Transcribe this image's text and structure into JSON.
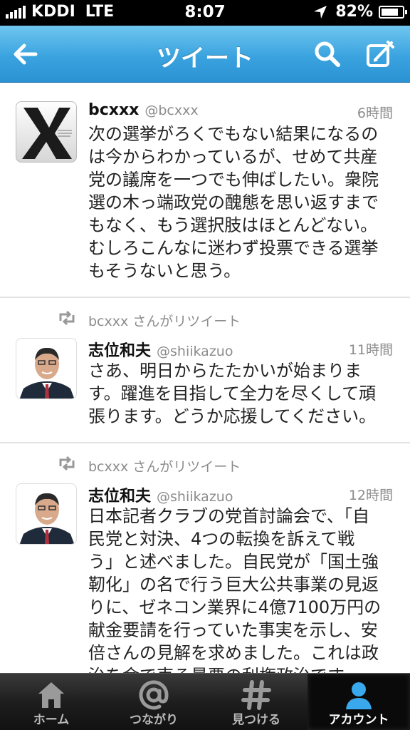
{
  "status_bar": {
    "carrier": "KDDI",
    "network": "LTE",
    "time": "8:07",
    "battery": "82%",
    "battery_level": 0.82
  },
  "nav": {
    "title": "ツイート"
  },
  "tweets": [
    {
      "name": "bcxxx",
      "handle": "@bcxxx",
      "time": "6時間",
      "lines": [
        "次の選挙がろくでもない結果になるの",
        "は今からわかっているが、せめて共産",
        "党の議席を一つでも伸ばしたい。衆院",
        "選の木っ端政党の醜態を思い返すまで",
        "もなく、もう選択肢はほとんどない。",
        "むしろこんなに迷わず投票できる選挙",
        "もそうないと思う。"
      ]
    },
    {
      "retweeted_by": "bcxxx さんがリツイート",
      "name": "志位和夫",
      "handle": "@shiikazuo",
      "time": "11時間",
      "lines": [
        "さあ、明日からたたかいが始まりま",
        "す。躍進を目指して全力を尽くして頑",
        "張ります。どうか応援してください。"
      ]
    },
    {
      "retweeted_by": "bcxxx さんがリツイート",
      "name": "志位和夫",
      "handle": "@shiikazuo",
      "time": "12時間",
      "lines": [
        "日本記者クラブの党首討論会で、「自",
        "民党と対決、4つの転換を訴えて戦",
        "う」と述べました。自民党が「国土強",
        "靭化」の名で行う巨大公共事業の見返",
        "りに、ゼネコン業界に4億7100万円の",
        "献金要請を行っていた事実を示し、安",
        "倍さんの見解を求めました。これは政",
        "治を金で売る最悪の利権政治です。"
      ]
    }
  ],
  "tabs": [
    {
      "label": "ホーム",
      "icon": "home-icon"
    },
    {
      "label": "つながり",
      "icon": "at-icon"
    },
    {
      "label": "見つける",
      "icon": "hash-icon"
    },
    {
      "label": "アカウント",
      "icon": "person-icon"
    }
  ],
  "colors": {
    "nav_top": "#6fc6f0",
    "nav_bottom": "#2b92d3",
    "active_tab_icon": "#3aa8ec"
  }
}
